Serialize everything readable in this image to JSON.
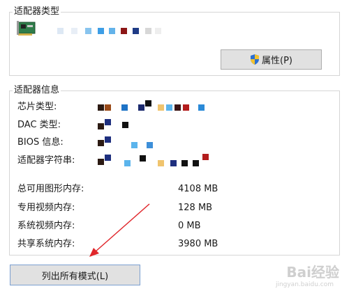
{
  "adapter_type": {
    "group_title": "适配器类型",
    "properties_button": "属性(P)"
  },
  "adapter_info": {
    "group_title": "适配器信息",
    "rows": [
      {
        "label": "芯片类型:"
      },
      {
        "label": "DAC 类型:"
      },
      {
        "label": "BIOS 信息:"
      },
      {
        "label": "适配器字符串:"
      }
    ],
    "memory": [
      {
        "label": "总可用图形内存:",
        "value": "4108 MB"
      },
      {
        "label": "专用视频内存:",
        "value": "128 MB"
      },
      {
        "label": "系统视频内存:",
        "value": "0 MB"
      },
      {
        "label": "共享系统内存:",
        "value": "3980 MB"
      }
    ]
  },
  "list_modes_button": "列出所有模式(L)",
  "watermark": {
    "text": "Bai经验",
    "sub": "jingyan.baidu.com"
  },
  "colors": {
    "annotation_arrow": "#e0262b",
    "shield_blue": "#2b6fd1",
    "shield_yellow": "#f2c12e"
  }
}
